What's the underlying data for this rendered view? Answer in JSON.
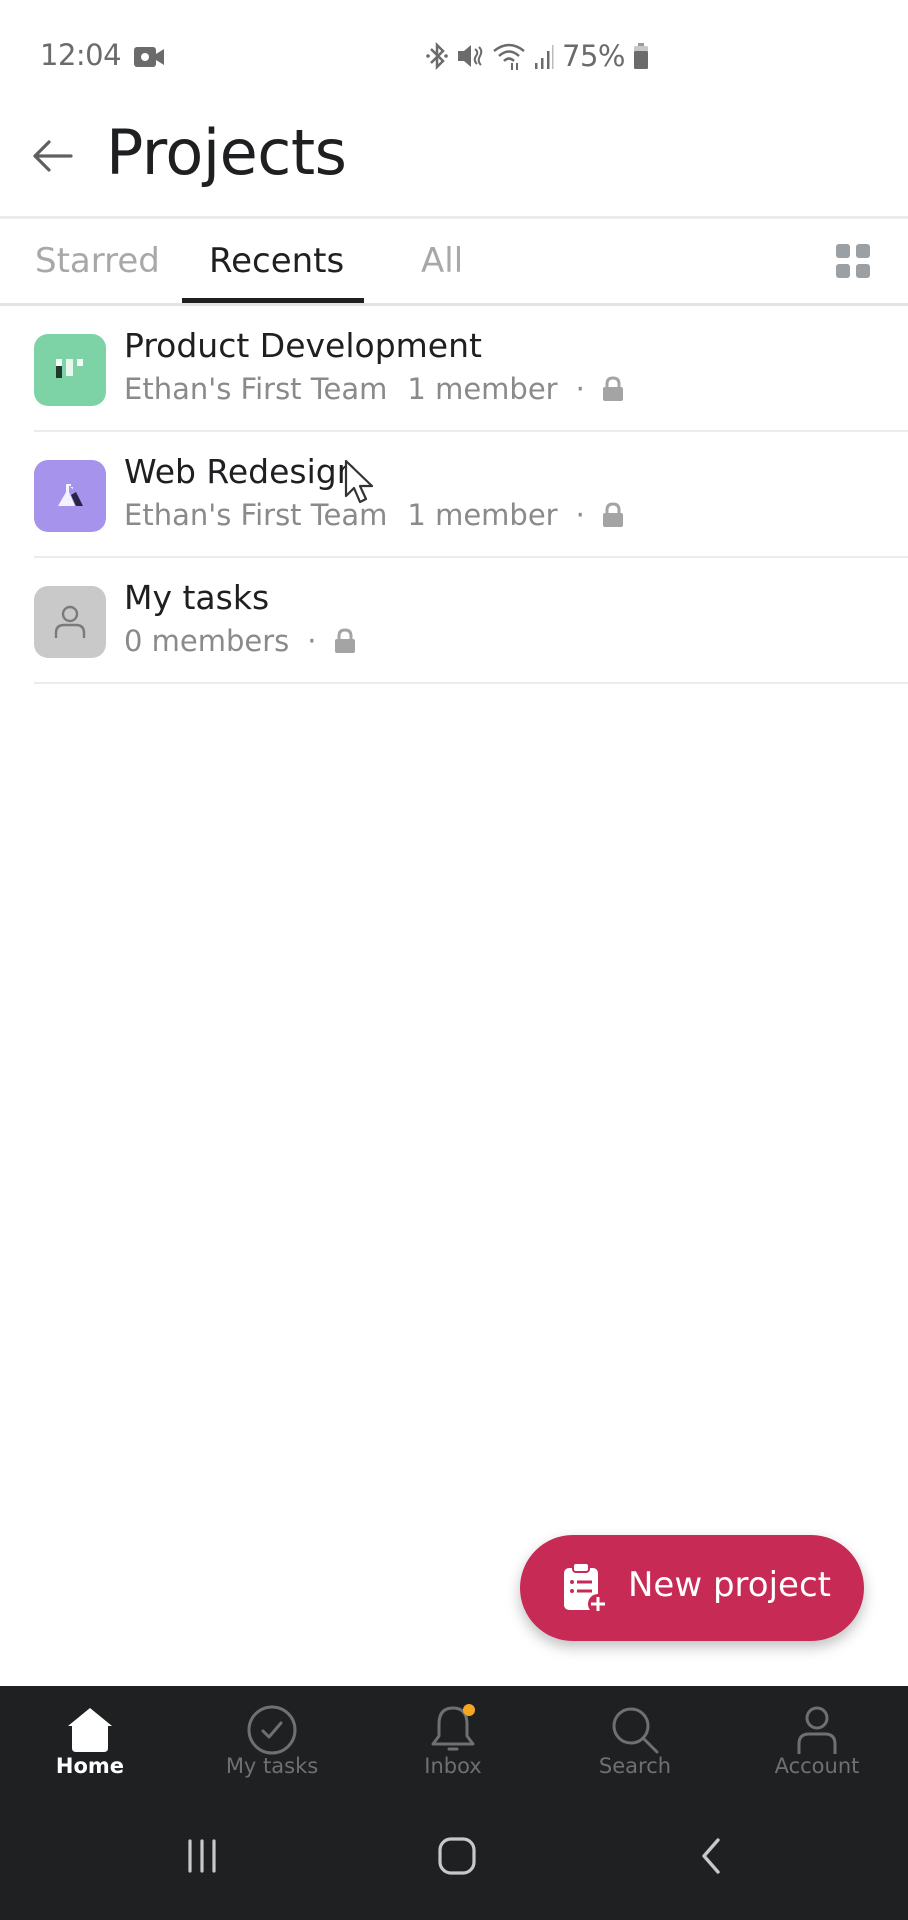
{
  "status_bar": {
    "time": "12:04",
    "battery": "75%",
    "icons": [
      "video-recording-icon",
      "bluetooth-icon",
      "mute-icon",
      "wifi-icon",
      "signal-icon",
      "battery-icon"
    ]
  },
  "header": {
    "title": "Projects",
    "back_icon": "arrow-left-icon"
  },
  "tabs": {
    "items": [
      {
        "label": "Starred",
        "active": false
      },
      {
        "label": "Recents",
        "active": true
      },
      {
        "label": "All",
        "active": false
      }
    ],
    "view_toggle_icon": "grid-icon"
  },
  "projects": [
    {
      "title": "Product Development",
      "team": "Ethan's First Team",
      "members": "1 member",
      "separator": "·",
      "private": true,
      "icon": "board-icon",
      "color": "#7dd3a5"
    },
    {
      "title": "Web Redesign",
      "team": "Ethan's First Team",
      "members": "1 member",
      "separator": "·",
      "private": true,
      "icon": "flask-icon",
      "color": "#a593ec"
    },
    {
      "title": "My tasks",
      "team": "",
      "members": "0 members",
      "separator": "·",
      "private": true,
      "icon": "person-icon",
      "color": "#c9c9c9"
    }
  ],
  "fab": {
    "label": "New project",
    "icon": "clipboard-plus-icon",
    "color": "#c62a55"
  },
  "bottom_nav": [
    {
      "label": "Home",
      "icon": "home-icon",
      "active": true
    },
    {
      "label": "My tasks",
      "icon": "check-circle-icon",
      "active": false
    },
    {
      "label": "Inbox",
      "icon": "bell-icon",
      "active": false,
      "badge": true,
      "badge_color": "#f5a623"
    },
    {
      "label": "Search",
      "icon": "search-icon",
      "active": false
    },
    {
      "label": "Account",
      "icon": "person-icon",
      "active": false
    }
  ],
  "system_nav": [
    "recents-button",
    "home-button",
    "back-button"
  ]
}
